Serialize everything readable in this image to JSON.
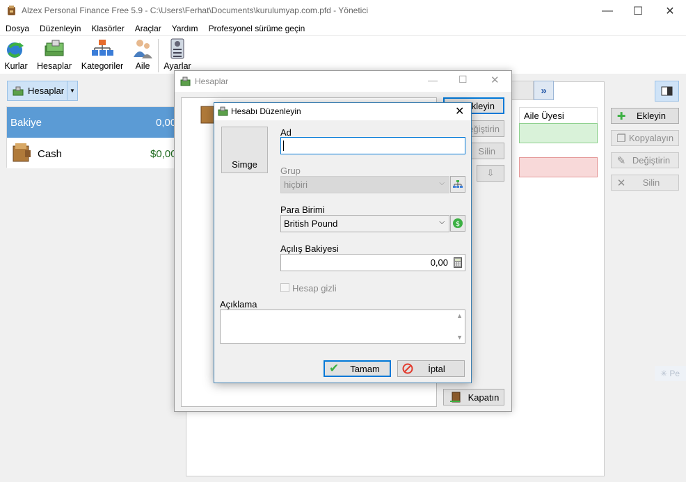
{
  "window": {
    "title": "Alzex Personal Finance Free 5.9 - C:\\Users\\Ferhat\\Documents\\kurulumyap.com.pfd - Yönetici",
    "minimize": "—",
    "maximize": "☐",
    "close": "✕"
  },
  "menu": [
    "Dosya",
    "Düzenleyin",
    "Klasörler",
    "Araçlar",
    "Yardım",
    "Profesyonel sürüme geçin"
  ],
  "toolbar": {
    "kurlar": "Kurlar",
    "hesaplar": "Hesaplar",
    "kategoriler": "Kategoriler",
    "aile": "Aile",
    "ayarlar": "Ayarlar"
  },
  "left_panel": {
    "dropdown_label": "Hesaplar",
    "balance_label": "Bakiye",
    "balance_value": "0,00",
    "accounts": [
      {
        "name": "Cash",
        "amount": "$0,00"
      }
    ]
  },
  "right_panel": {
    "column_header": "Aile Üyesi",
    "buttons": {
      "add": "Ekleyin",
      "copy": "Kopyalayın",
      "edit": "Değiştirin",
      "delete": "Silin"
    },
    "ghost_text": "Pe"
  },
  "hesaplar_dialog": {
    "title": "Hesaplar",
    "add": "Ekleyin",
    "edit": "Değiştirin",
    "delete": "Silin",
    "close_button": "Kapatın"
  },
  "edit_dialog": {
    "title": "Hesabı Düzenleyin",
    "icon_button": "Simge",
    "name_label": "Ad",
    "name_value": "",
    "group_label": "Grup",
    "group_value": "hiçbiri",
    "currency_label": "Para Birimi",
    "currency_value": "British Pound",
    "opening_label": "Açılış Bakiyesi",
    "opening_value": "0,00",
    "hidden_label": "Hesap gizli",
    "hidden_checked": false,
    "description_label": "Açıklama",
    "description_value": "",
    "ok": "Tamam",
    "cancel": "İptal"
  }
}
